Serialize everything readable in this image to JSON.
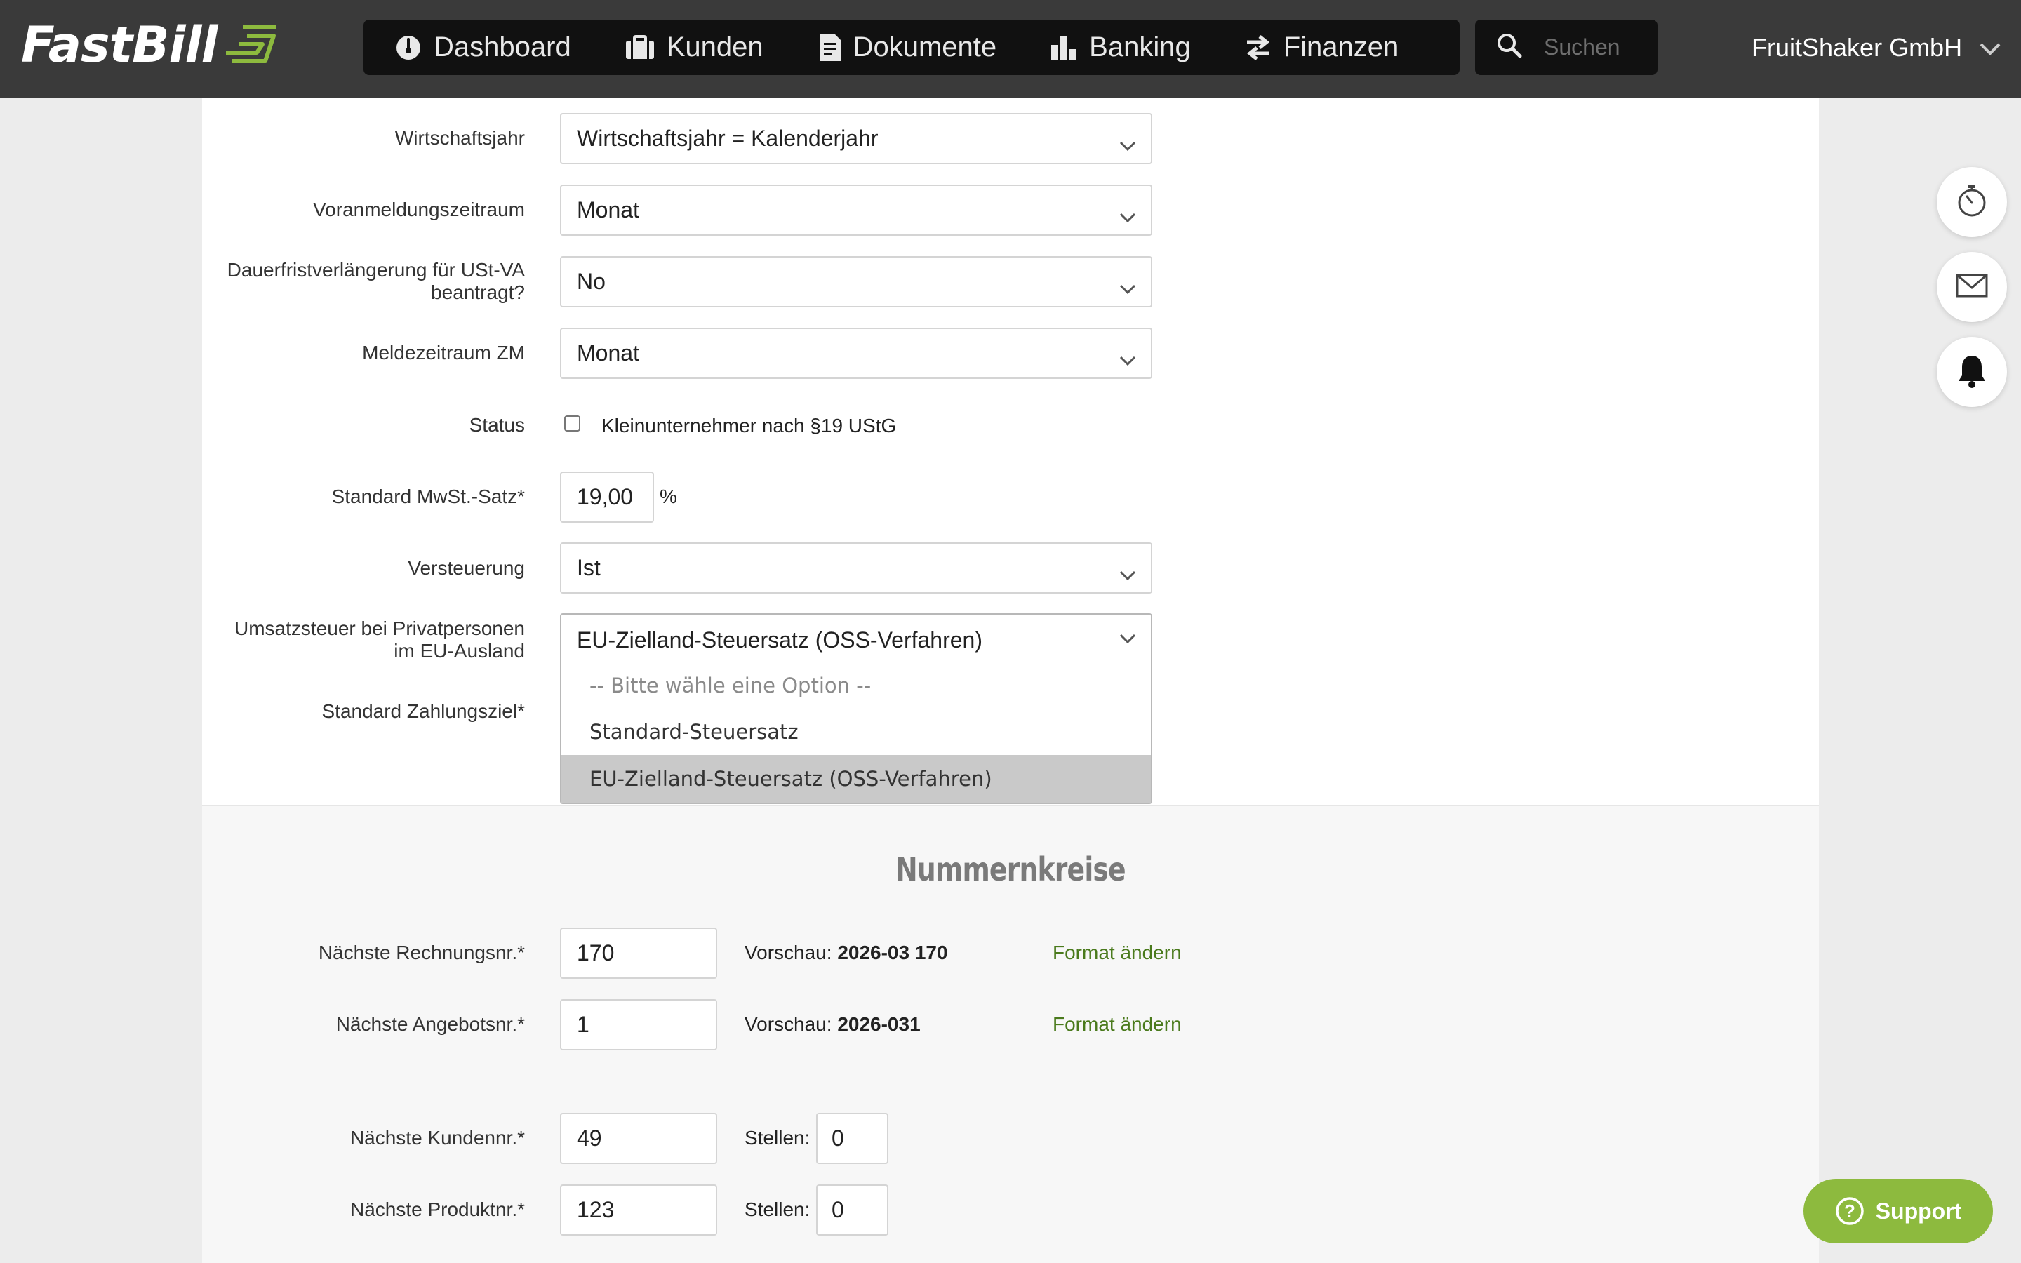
{
  "app": {
    "logo_text": "FastBill",
    "brand_color": "#8dba3e"
  },
  "nav": {
    "items": [
      {
        "label": "Dashboard",
        "icon": "gauge-icon"
      },
      {
        "label": "Kunden",
        "icon": "briefcase-icon"
      },
      {
        "label": "Dokumente",
        "icon": "document-icon"
      },
      {
        "label": "Banking",
        "icon": "bar-chart-icon"
      },
      {
        "label": "Finanzen",
        "icon": "transfer-arrows-icon"
      }
    ],
    "search_placeholder": "Suchen",
    "company": "FruitShaker GmbH"
  },
  "form": {
    "wirtschaftsjahr": {
      "label": "Wirtschaftsjahr",
      "value": "Wirtschaftsjahr = Kalenderjahr"
    },
    "voranmeldung": {
      "label": "Voranmeldungszeitraum",
      "value": "Monat"
    },
    "dauerfrist": {
      "label_line1": "Dauerfristverlängerung für USt-VA",
      "label_line2": "beantragt?",
      "value": "No"
    },
    "meldezeitraum": {
      "label": "Meldezeitraum ZM",
      "value": "Monat"
    },
    "status": {
      "label": "Status",
      "checkbox_label": "Kleinunternehmer nach §19 UStG",
      "checked": false
    },
    "mwst": {
      "label": "Standard MwSt.-Satz*",
      "value": "19,00",
      "unit": "%"
    },
    "versteuerung": {
      "label": "Versteuerung",
      "value": "Ist"
    },
    "privatpersonen": {
      "label_line1": "Umsatzsteuer bei Privatpersonen",
      "label_line2": "im EU-Ausland",
      "value": "EU-Zielland-Steuersatz (OSS-Verfahren)",
      "options": [
        "-- Bitte wähle eine Option --",
        "Standard-Steuersatz",
        "EU-Zielland-Steuersatz (OSS-Verfahren)"
      ]
    },
    "zahlungsziel": {
      "label": "Standard Zahlungsziel*"
    }
  },
  "nummernkreise": {
    "title": "Nummernkreise",
    "rechnung": {
      "label": "Nächste Rechnungsnr.*",
      "value": "170",
      "preview_label": "Vorschau:",
      "preview_value": "2026-03 170",
      "link": "Format ändern"
    },
    "angebot": {
      "label": "Nächste Angebotsnr.*",
      "value": "1",
      "preview_label": "Vorschau:",
      "preview_value": "2026-031",
      "link": "Format ändern"
    },
    "kunde": {
      "label": "Nächste Kundennr.*",
      "value": "49",
      "stellen_label": "Stellen:",
      "stellen_value": "0"
    },
    "produkt": {
      "label": "Nächste Produktnr.*",
      "value": "123",
      "stellen_label": "Stellen:",
      "stellen_value": "0"
    }
  },
  "side": {
    "timer_icon": "stopwatch-icon",
    "mail_icon": "envelope-icon",
    "bell_icon": "bell-icon"
  },
  "support": {
    "label": "Support"
  }
}
